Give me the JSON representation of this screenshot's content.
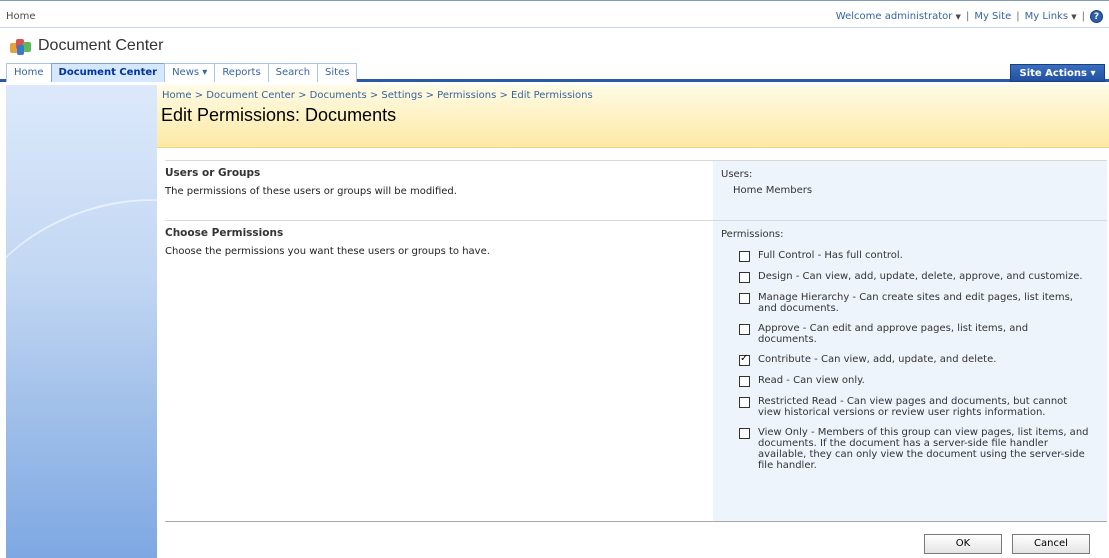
{
  "topbar": {
    "home": "Home",
    "welcome": "Welcome administrator",
    "my_site": "My Site",
    "my_links": "My Links",
    "separator": "|",
    "help": "?"
  },
  "site": {
    "title": "Document Center"
  },
  "nav": {
    "tabs": [
      {
        "label": "Home"
      },
      {
        "label": "Document Center",
        "active": true
      },
      {
        "label": "News ▾"
      },
      {
        "label": "Reports"
      },
      {
        "label": "Search"
      },
      {
        "label": "Sites"
      }
    ],
    "site_actions": "Site Actions ▾"
  },
  "breadcrumb": "Home > Document Center > Documents > Settings > Permissions > Edit Permissions",
  "page_title": "Edit Permissions: Documents",
  "users_section": {
    "heading": "Users or Groups",
    "description": "The permissions of these users or groups will be modified.",
    "label": "Users:",
    "value": "Home Members"
  },
  "permissions_section": {
    "heading": "Choose Permissions",
    "description": "Choose the permissions you want these users or groups to have.",
    "label": "Permissions:",
    "items": [
      {
        "text": "Full Control - Has full control.",
        "checked": false
      },
      {
        "text": "Design - Can view, add, update, delete, approve, and customize.",
        "checked": false
      },
      {
        "text": "Manage Hierarchy - Can create sites and edit pages, list items, and documents.",
        "checked": false
      },
      {
        "text": "Approve - Can edit and approve pages, list items, and documents.",
        "checked": false
      },
      {
        "text": "Contribute - Can view, add, update, and delete.",
        "checked": true
      },
      {
        "text": "Read - Can view only.",
        "checked": false
      },
      {
        "text": "Restricted Read - Can view pages and documents, but cannot view historical versions or review user rights information.",
        "checked": false
      },
      {
        "text": "View Only - Members of this group can view pages, list items, and documents. If the document has a server-side file handler available, they can only view the document using the server-side file handler.",
        "checked": false
      }
    ]
  },
  "buttons": {
    "ok": "OK",
    "cancel": "Cancel"
  },
  "colors": {
    "accent": "#2a5aa6",
    "title_bg": "#fde9a4",
    "link": "#3764a0"
  }
}
